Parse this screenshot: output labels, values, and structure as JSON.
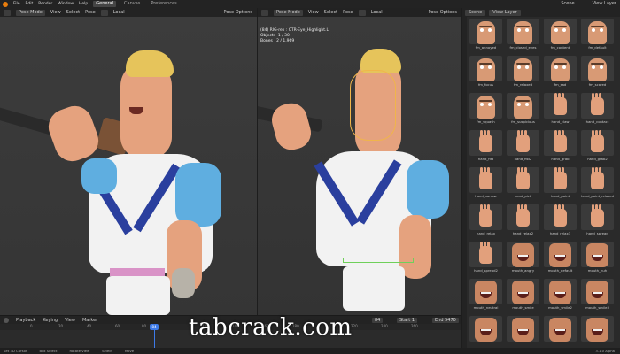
{
  "menubar": {
    "items": [
      "File",
      "Edit",
      "Render",
      "Window",
      "Help"
    ],
    "workspaces": [
      "General",
      "Canvas",
      "Preferences"
    ],
    "scene": "Scene",
    "view_layer": "View Layer"
  },
  "viewport_left": {
    "mode": "Pose Mode",
    "menus": [
      "View",
      "Select",
      "Pose"
    ],
    "transform": "Local",
    "pose_options": "Pose Options"
  },
  "viewport_right": {
    "mode": "Pose Mode",
    "menus": [
      "View",
      "Select",
      "Pose"
    ],
    "transform": "Local",
    "pose_options": "Pose Options",
    "info_title": "(84) RIG-rex : CTR-Eye_Highlight.L",
    "objects_label": "Objects",
    "objects_value": "1 / 30",
    "bones_label": "Bones",
    "bones_value": "2 / 1,969"
  },
  "asset_browser": {
    "tiles": [
      {
        "label": "fm_annoyed",
        "kind": "face"
      },
      {
        "label": "fm_closed_eyes",
        "kind": "face"
      },
      {
        "label": "fm_content",
        "kind": "face"
      },
      {
        "label": "fm_default",
        "kind": "face"
      },
      {
        "label": "fm_focus",
        "kind": "face"
      },
      {
        "label": "fm_relaxed",
        "kind": "face"
      },
      {
        "label": "fm_sad",
        "kind": "face"
      },
      {
        "label": "fm_scared",
        "kind": "face"
      },
      {
        "label": "fm_squash",
        "kind": "face"
      },
      {
        "label": "fm_suspicious",
        "kind": "face"
      },
      {
        "label": "hand_claw",
        "kind": "hand"
      },
      {
        "label": "hand_contact",
        "kind": "hand"
      },
      {
        "label": "hand_fist",
        "kind": "hand"
      },
      {
        "label": "hand_fist2",
        "kind": "hand"
      },
      {
        "label": "hand_grab",
        "kind": "hand"
      },
      {
        "label": "hand_grab2",
        "kind": "hand"
      },
      {
        "label": "hand_narrow",
        "kind": "hand"
      },
      {
        "label": "hand_pick",
        "kind": "hand"
      },
      {
        "label": "hand_point",
        "kind": "hand"
      },
      {
        "label": "hand_point_relaxed",
        "kind": "hand"
      },
      {
        "label": "hand_relax",
        "kind": "hand"
      },
      {
        "label": "hand_relax2",
        "kind": "hand"
      },
      {
        "label": "hand_relax3",
        "kind": "hand"
      },
      {
        "label": "hand_spread",
        "kind": "hand"
      },
      {
        "label": "hand_spread2",
        "kind": "hand"
      },
      {
        "label": "mouth_angry",
        "kind": "mouth"
      },
      {
        "label": "mouth_default",
        "kind": "mouth"
      },
      {
        "label": "mouth_huh",
        "kind": "mouth"
      },
      {
        "label": "mouth_neutral",
        "kind": "mouth"
      },
      {
        "label": "mouth_smile",
        "kind": "mouth"
      },
      {
        "label": "mouth_smile2",
        "kind": "mouth"
      },
      {
        "label": "mouth_smile3",
        "kind": "mouth"
      },
      {
        "label": "",
        "kind": "mouth"
      },
      {
        "label": "",
        "kind": "mouth"
      },
      {
        "label": "",
        "kind": "mouth"
      },
      {
        "label": "",
        "kind": "mouth"
      }
    ]
  },
  "timeline": {
    "menus": [
      "Playback",
      "Keying",
      "View",
      "Marker"
    ],
    "current_frame": "84",
    "start_label": "Start",
    "start_value": "1",
    "end_label": "End",
    "end_value": "5470",
    "playhead": "84",
    "ticks": [
      "0",
      "20",
      "40",
      "60",
      "80",
      "120",
      "140",
      "160",
      "180",
      "220",
      "240",
      "260"
    ]
  },
  "statusbar": {
    "items": [
      "Set 3D Cursor",
      "Box Select",
      "Rotate View",
      "Select",
      "Move"
    ],
    "version": "3.1.0 Alpha"
  },
  "watermark": "tabcrack.com"
}
